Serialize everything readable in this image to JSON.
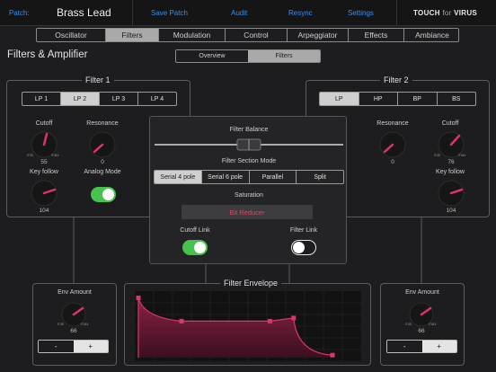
{
  "topbar": {
    "patch_label": "Patch:",
    "patch_name": "Brass Lead",
    "buttons": [
      "Save Patch",
      "Audit",
      "Resync",
      "Settings"
    ],
    "brand_touch": "TOUCH",
    "brand_for": "for",
    "brand_virus": "VIRUS"
  },
  "main_tabs": {
    "items": [
      "Oscillator",
      "Filters",
      "Modulation",
      "Control",
      "Arpeggiator",
      "Effects",
      "Ambiance"
    ],
    "selected": "Filters"
  },
  "page_title": "Filters & Amplifier",
  "sub_tabs": {
    "items": [
      "Overview",
      "Filters"
    ],
    "selected": "Filters"
  },
  "filter1": {
    "title": "Filter 1",
    "types": [
      "LP 1",
      "LP 2",
      "LP 3",
      "LP 4"
    ],
    "selected_type": "LP 2",
    "cutoff": {
      "label": "Cutoff",
      "value": "55",
      "min": "min",
      "max": "max"
    },
    "resonance": {
      "label": "Resonance",
      "value": "0"
    },
    "key_follow": {
      "label": "Key follow",
      "value": "104"
    },
    "analog_mode": {
      "label": "Analog Mode",
      "state": "on"
    }
  },
  "filter2": {
    "title": "Filter 2",
    "types": [
      "LP",
      "HP",
      "BP",
      "BS"
    ],
    "selected_type": "LP",
    "cutoff": {
      "label": "Cutoff",
      "value": "76",
      "min": "min",
      "max": "max"
    },
    "resonance": {
      "label": "Resonance",
      "value": "0"
    },
    "key_follow": {
      "label": "Key follow",
      "value": "104"
    }
  },
  "center": {
    "balance_label": "Filter Balance",
    "balance_value": 0.5,
    "section_mode_label": "Filter Section Mode",
    "modes": [
      "Serial 4 pole",
      "Serial 6 pole",
      "Parallel",
      "Split"
    ],
    "selected_mode": "Serial 4 pole",
    "saturation_label": "Saturation",
    "saturation_value": "Bit Reducer",
    "cutoff_link": {
      "label": "Cutoff Link",
      "state": "on"
    },
    "filter_link": {
      "label": "Filter Link",
      "state": "off"
    }
  },
  "env_left": {
    "label": "Env Amount",
    "value": "66",
    "min": "min",
    "max": "max",
    "minus": "-",
    "plus": "+"
  },
  "env_right": {
    "label": "Env Amount",
    "value": "66",
    "min": "min",
    "max": "max",
    "minus": "-",
    "plus": "+"
  },
  "envelope": {
    "title": "Filter Envelope",
    "points": [
      {
        "name": "attack",
        "t": 0.0,
        "level": 0.95
      },
      {
        "name": "decay",
        "t": 0.2,
        "level": 0.58
      },
      {
        "name": "sustain",
        "t": 0.61,
        "level": 0.58
      },
      {
        "name": "sustain-slope",
        "t": 0.72,
        "level": 0.63
      },
      {
        "name": "release",
        "t": 0.9,
        "level": 0.04
      }
    ]
  },
  "colors": {
    "accent": "#e0336a",
    "toggle_on": "#46c34c",
    "link": "#3a8ee6",
    "saturation_text": "#d24a6f"
  }
}
